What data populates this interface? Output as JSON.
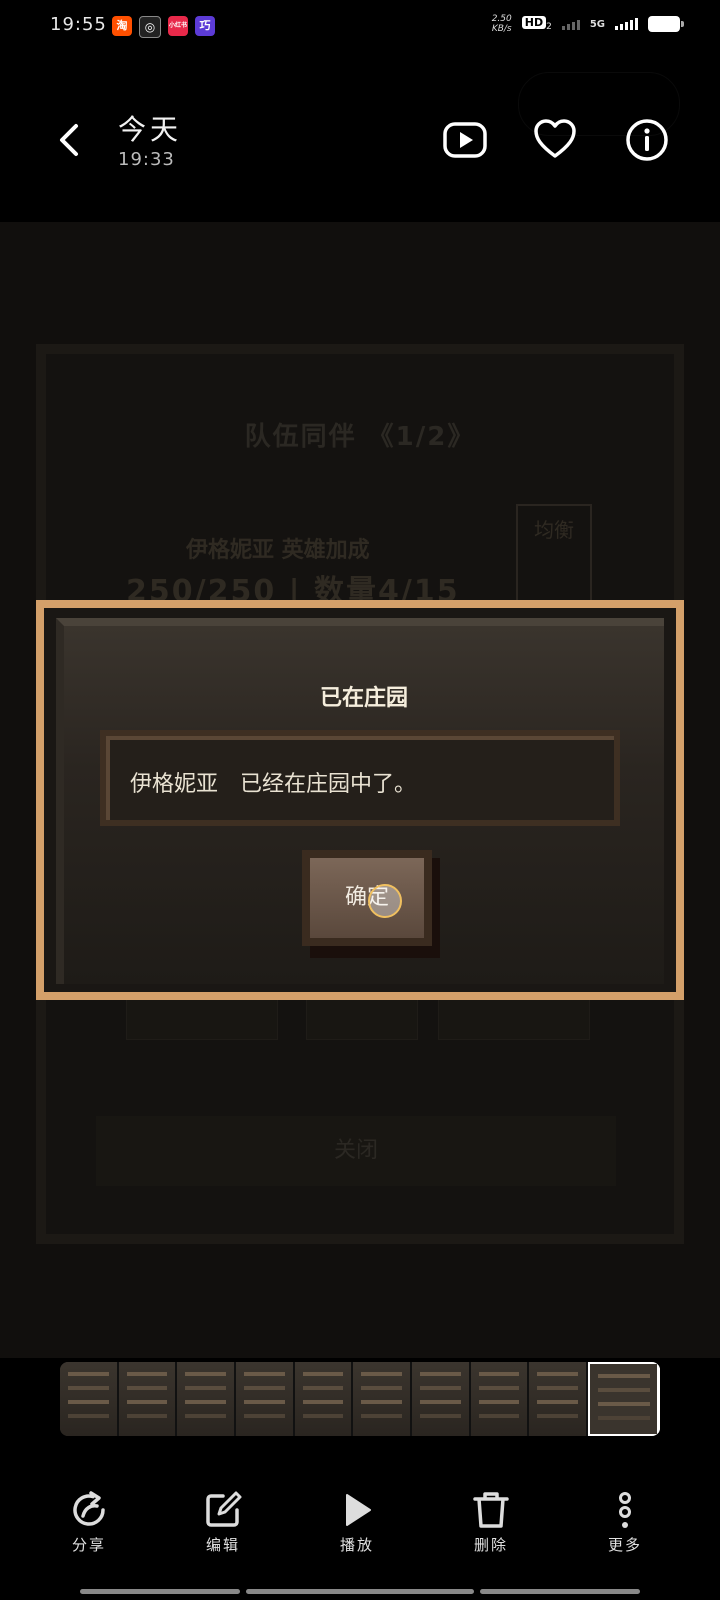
{
  "status_bar": {
    "time": "19:55",
    "app_icons": [
      {
        "name": "taobao-icon",
        "glyph": "淘",
        "color": "#ff5000"
      },
      {
        "name": "swirl-app-icon",
        "glyph": "◎",
        "color": "#222222"
      },
      {
        "name": "xiaohongshu-icon",
        "glyph": "小红书",
        "color": "#e8294a"
      },
      {
        "name": "vip-app-icon",
        "glyph": "巧",
        "color": "#5c3bd6"
      }
    ],
    "net_speed_value": "2.50",
    "net_speed_unit": "KB/s",
    "hd_label": "HD",
    "hd_sub": "2",
    "network": "5G",
    "battery_percent": 0.85
  },
  "header": {
    "title": "今天",
    "subtitle": "19:33",
    "icons": [
      "back-icon",
      "play-icon",
      "favorite-icon",
      "info-icon"
    ]
  },
  "background_screen": {
    "title": "队伍同伴 《1/2》",
    "hero_line": "伊格妮亚 英雄加成",
    "hp_line": "250/250 | 数量4/15",
    "side_label": "均衡",
    "close_label": "关闭"
  },
  "dialog": {
    "title": "已在庄园",
    "message": "伊格妮亚　已经在庄园中了。",
    "confirm_label": "确定",
    "border_color": "#d4a06a"
  },
  "thumbnails": {
    "count": 10,
    "active_index": 9
  },
  "toolbar": {
    "items": [
      {
        "name": "share-button",
        "icon": "share-icon",
        "label": "分享"
      },
      {
        "name": "edit-button",
        "icon": "edit-icon",
        "label": "编辑"
      },
      {
        "name": "play-button",
        "icon": "play-icon",
        "label": "播放"
      },
      {
        "name": "delete-button",
        "icon": "trash-icon",
        "label": "删除"
      },
      {
        "name": "more-button",
        "icon": "more-vertical-icon",
        "label": "更多"
      }
    ]
  }
}
